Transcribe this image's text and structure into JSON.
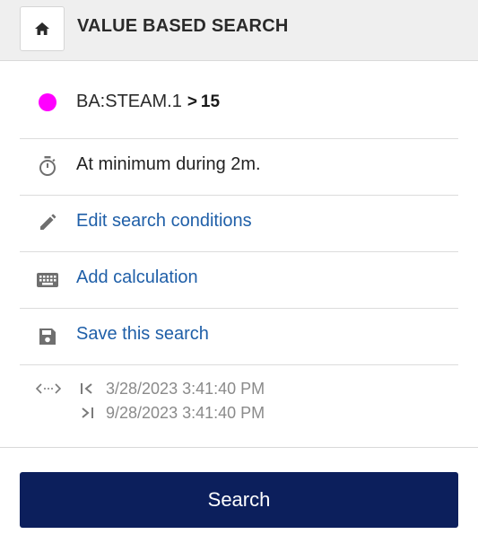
{
  "header": {
    "title": "VALUE BASED SEARCH",
    "home_icon": "home-icon"
  },
  "condition": {
    "color": "#ff00ff",
    "tag": "BA:STEAM.1",
    "operator": ">",
    "threshold": "15"
  },
  "duration": {
    "icon": "timer-icon",
    "text": "At minimum during 2m."
  },
  "actions": [
    {
      "icon": "pencil-icon",
      "label": "Edit search conditions"
    },
    {
      "icon": "keyboard-icon",
      "label": "Add calculation"
    },
    {
      "icon": "save-icon",
      "label": "Save this search"
    }
  ],
  "time_range": {
    "icon": "range-icon",
    "start": "3/28/2023 3:41:40 PM",
    "end": "9/28/2023 3:41:40 PM"
  },
  "search_button": {
    "label": "Search",
    "color": "#0c1f5c"
  },
  "colors": {
    "link": "#1f5fa8",
    "header_bg": "#efefef"
  }
}
